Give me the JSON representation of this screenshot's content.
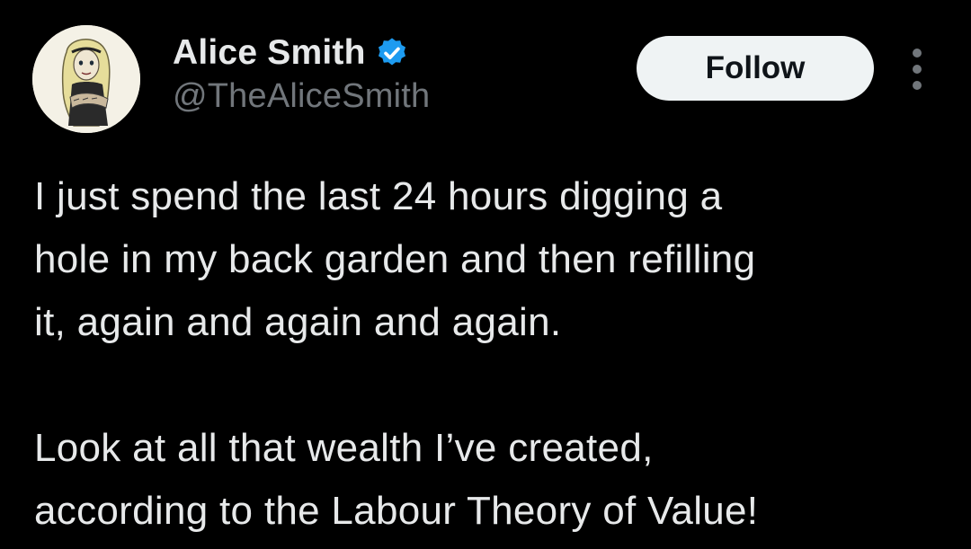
{
  "author": {
    "display_name": "Alice Smith",
    "handle": "@TheAliceSmith",
    "verified": true,
    "avatar_icon": "avatar-cartoon-woman"
  },
  "actions": {
    "follow_label": "Follow",
    "more_icon": "more-vertical-icon"
  },
  "tweet": {
    "paragraph_1": "I just spend  the last 24 hours digging a\nhole in my back garden and then refilling\nit, again and again and again.",
    "paragraph_2": "Look at all that wealth I’ve created,\naccording to the Labour Theory of Value!"
  },
  "colors": {
    "background": "#000000",
    "text_primary": "#e7e9ea",
    "text_secondary": "#71767b",
    "verified_blue": "#1d9bf0",
    "follow_bg": "#eff3f4",
    "follow_text": "#0f1419"
  }
}
